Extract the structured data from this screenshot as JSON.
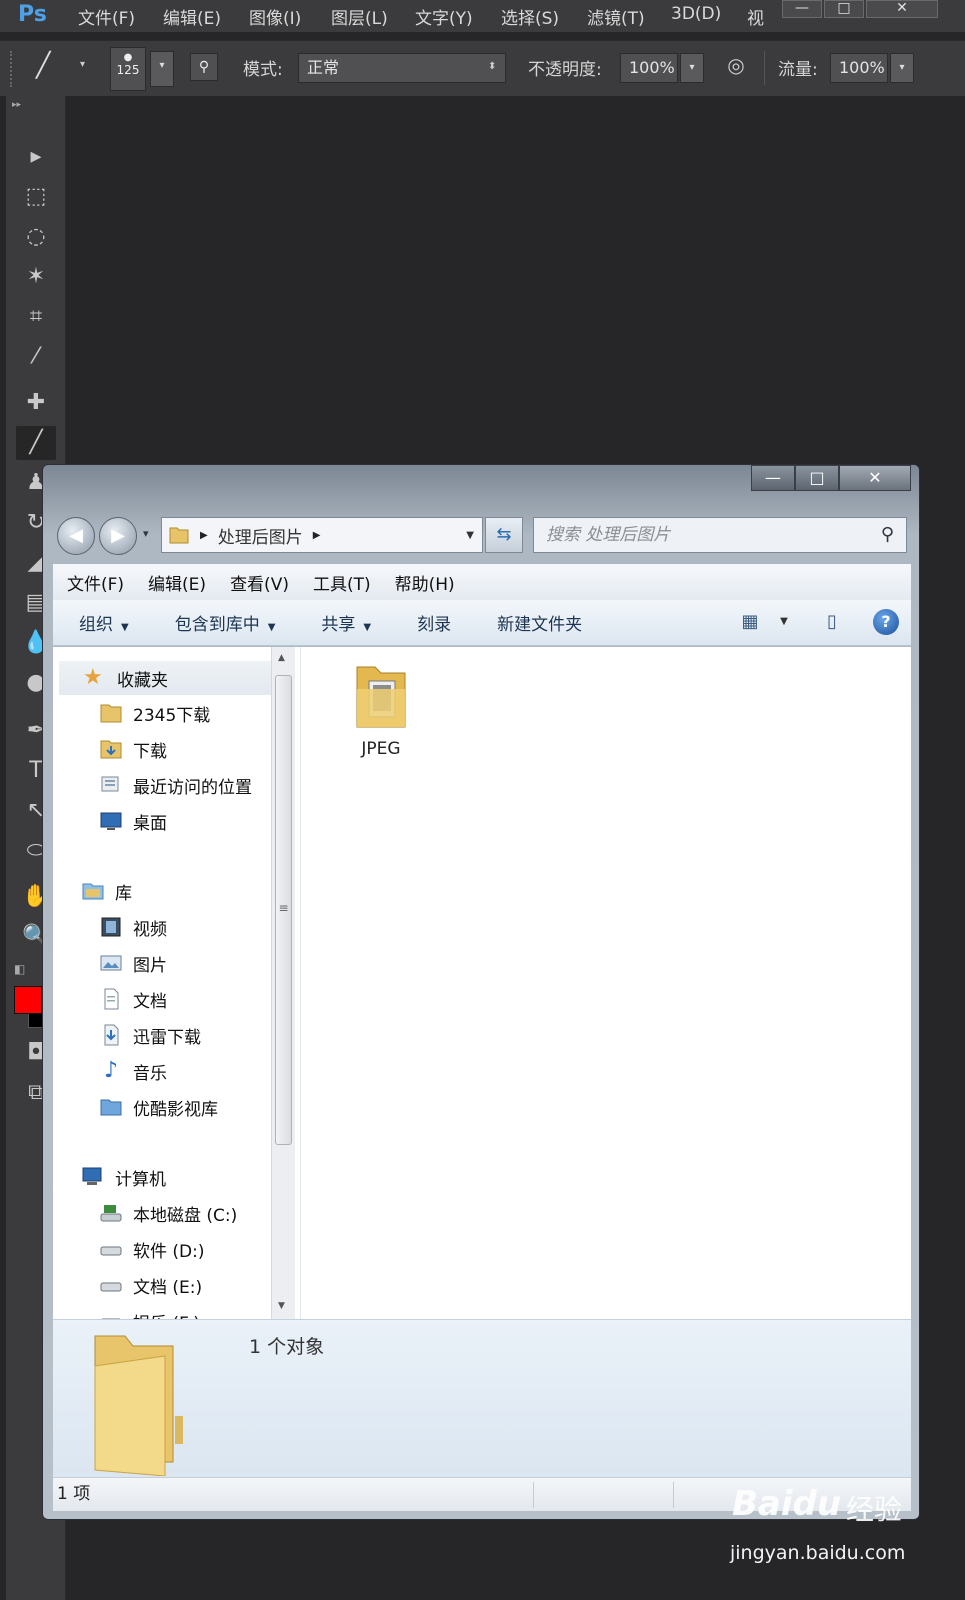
{
  "ps": {
    "logo": "Ps",
    "menu": [
      "文件(F)",
      "编辑(E)",
      "图像(I)",
      "图层(L)",
      "文字(Y)",
      "选择(S)",
      "滤镜(T)",
      "3D(D)",
      "视"
    ],
    "options": {
      "brush_size": "125",
      "mode_label": "模式:",
      "mode_value": "正常",
      "opacity_label": "不透明度:",
      "opacity_value": "100%",
      "flow_label": "流量:",
      "flow_value": "100%"
    },
    "colors": {
      "foreground": "#ff0000",
      "background": "#000000"
    }
  },
  "explorer": {
    "address": {
      "path": "处理后图片"
    },
    "search_placeholder": "搜索 处理后图片",
    "menu": [
      "文件(F)",
      "编辑(E)",
      "查看(V)",
      "工具(T)",
      "帮助(H)"
    ],
    "commands": {
      "organize": "组织",
      "include": "包含到库中",
      "share": "共享",
      "burn": "刻录",
      "new_folder": "新建文件夹"
    },
    "nav": {
      "favorites": {
        "label": "收藏夹",
        "items": [
          "2345下载",
          "下载",
          "最近访问的位置",
          "桌面"
        ]
      },
      "libraries": {
        "label": "库",
        "items": [
          "视频",
          "图片",
          "文档",
          "迅雷下载",
          "音乐",
          "优酷影视库"
        ]
      },
      "computer": {
        "label": "计算机",
        "items": [
          "本地磁盘 (C:)",
          "软件 (D:)",
          "文档 (E:)",
          "娱乐 (F:)"
        ]
      }
    },
    "files": [
      {
        "name": "JPEG",
        "icon": "folder-icon"
      }
    ],
    "details": {
      "count": "1 个对象"
    },
    "status": {
      "items": "1 项"
    }
  },
  "watermark": {
    "brand": "Baidu",
    "product": "经验",
    "url": "jingyan.baidu.com"
  }
}
